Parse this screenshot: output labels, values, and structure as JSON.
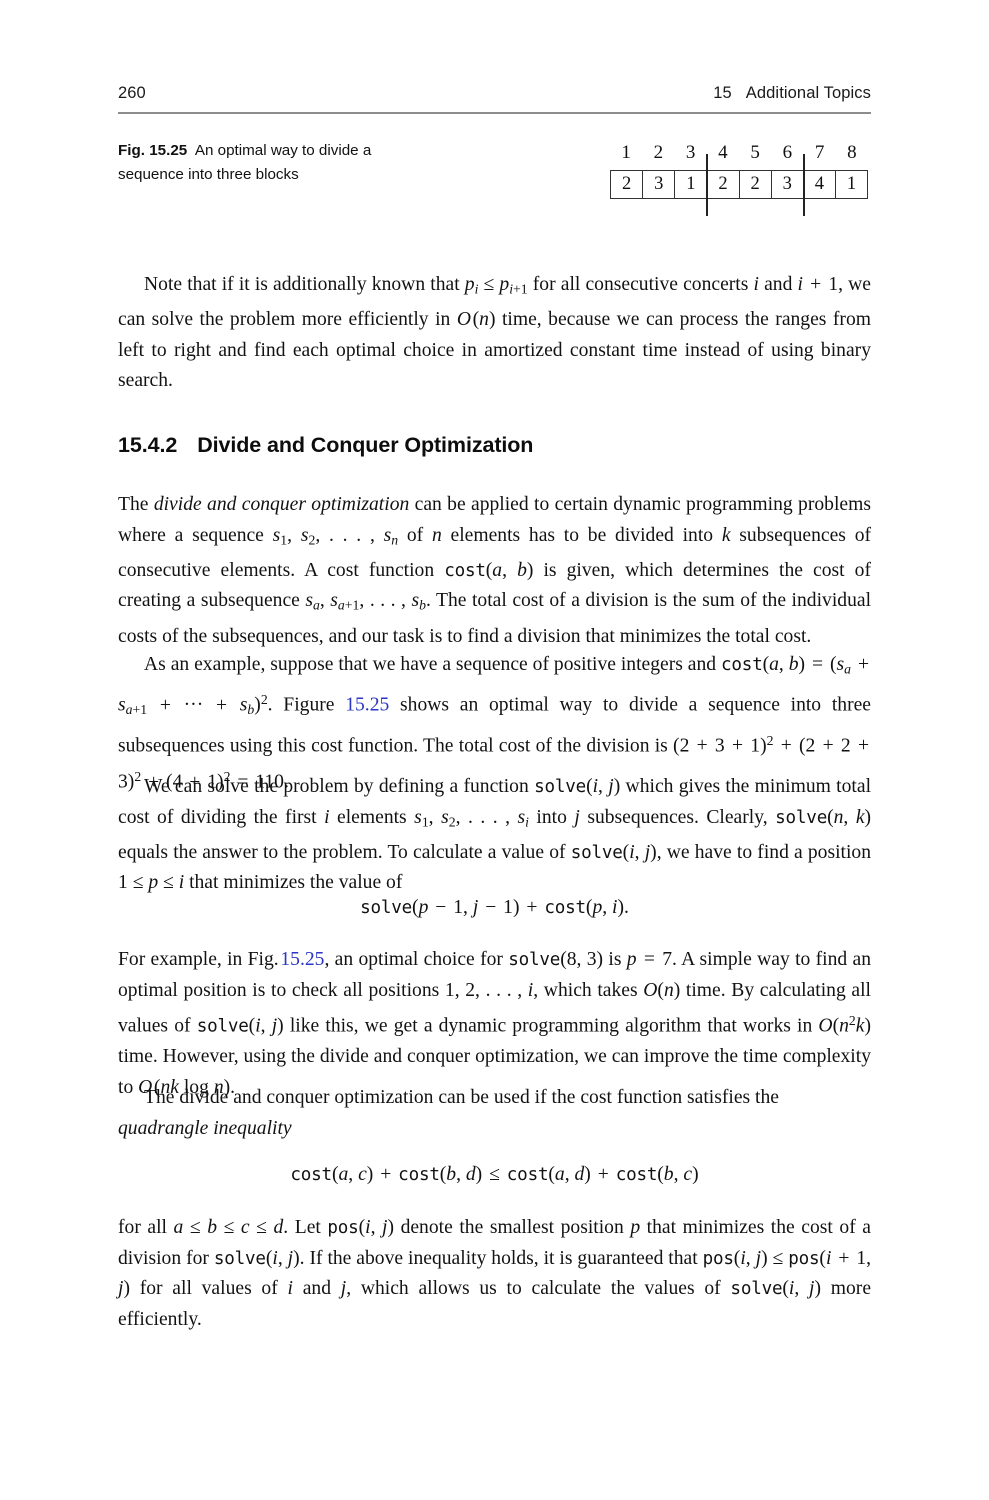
{
  "page": {
    "folio": "260",
    "chapter_number": "15",
    "chapter_title": "Additional Topics"
  },
  "figure": {
    "label": "Fig. 15.25",
    "caption": "An optimal way to divide a sequence into three blocks",
    "indices": [
      "1",
      "2",
      "3",
      "4",
      "5",
      "6",
      "7",
      "8"
    ],
    "values": [
      "2",
      "3",
      "1",
      "2",
      "2",
      "3",
      "4",
      "1"
    ],
    "dividers_after": [
      3,
      6
    ]
  },
  "section": {
    "number": "15.4.2",
    "title": "Divide and Conquer Optimization"
  },
  "paragraphs": {
    "p_note": "Note that if it is additionally known that pᵢ ≤ pᵢ₊₁ for all consecutive concerts i and i + 1, we can solve the problem more efficiently in O(n) time, because we can process the ranges from left to right and find each optimal choice in amortized constant time instead of using binary search.",
    "p_intro": "The divide and conquer optimization can be applied to certain dynamic programming problems where a sequence s₁, s₂, …, sₙ of n elements has to be divided into k subsequences of consecutive elements. A cost function cost(a, b) is given, which determines the cost of creating a subsequence sₐ, sₐ₊₁, …, sₔ. The total cost of a division is the sum of the individual costs of the subsequences, and our task is to find a division that minimizes the total cost.",
    "p_example": "As an example, suppose that we have a sequence of positive integers and cost(a, b) = (sₐ + sₐ₊₁ + ⋯ + sₔ)². Figure 15.25 shows an optimal way to divide a sequence into three subsequences using this cost function. The total cost of the division is (2 + 3 + 1)² + (2 + 2 + 3)² + (4 + 1)² = 110.",
    "p_solve": "We can solve the problem by defining a function solve(i, j) which gives the minimum total cost of dividing the first i elements s₁, s₂, …, sᵢ into j subsequences. Clearly, solve(n, k) equals the answer to the problem. To calculate a value of solve(i, j), we have to find a position 1 ≤ p ≤ i that minimizes the value of",
    "p_forexample": "For example, in Fig. 15.25, an optimal choice for solve(8, 3) is p = 7. A simple way to find an optimal position is to check all positions 1, 2, …, i, which takes O(n) time. By calculating all values of solve(i, j) like this, we get a dynamic programming algorithm that works in O(n²k) time. However, using the divide and conquer optimization, we can improve the time complexity to O(nk log n).",
    "p_quadrangle": "The divide and conquer optimization can be used if the cost function satisfies the quadrangle inequality",
    "p_pos": "for all a ≤ b ≤ c ≤ d. Let pos(i, j) denote the smallest position p that minimizes the cost of a division for solve(i, j). If the above inequality holds, it is guaranteed that pos(i, j) ≤ pos(i + 1, j) for all values of i and j, which allows us to calculate the values of solve(i, j) more efficiently."
  },
  "display_equations": {
    "eq_solve": "solve(p − 1, j − 1) + cost(p, i).",
    "eq_quadrangle": "cost(a, c) + cost(b, d) ≤ cost(a, d) + cost(b, c)"
  },
  "inline_references": {
    "fig_ref_1": "15.25",
    "fig_ref_2": "15.25"
  },
  "colors": {
    "link": "#2b36c4",
    "rule": "#8d8d8d",
    "text": "#121212"
  }
}
